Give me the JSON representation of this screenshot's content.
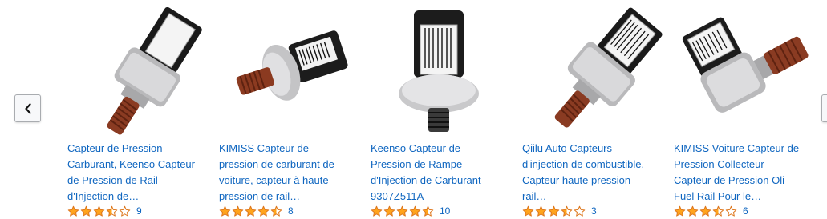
{
  "carousel": {
    "prev_icon": "chevron-left-icon",
    "products": [
      {
        "title": "Capteur de Pression Carburant, Keenso Capteur de Pression de Rail d'Injection de…",
        "rating": 3.5,
        "reviews": "9"
      },
      {
        "title": "KIMISS Capteur de pression de carburant de voiture, capteur à haute pression de rail…",
        "rating": 4.5,
        "reviews": "8"
      },
      {
        "title": "Keenso Capteur de Pression de Rampe d'Injection de Carburant 9307Z511A",
        "rating": 4.5,
        "reviews": "10"
      },
      {
        "title": "Qiilu Auto Capteurs d'injection de combustible, Capteur haute pression rail…",
        "rating": 3.5,
        "reviews": "3"
      },
      {
        "title": "KIMISS Voiture Capteur de Pression Collecteur Capteur de Pression Oli Fuel Rail Pour le…",
        "rating": 3.5,
        "reviews": "6"
      }
    ]
  },
  "colors": {
    "link": "#0f66c0",
    "star": "#ffa41c",
    "star_outline": "#de7921"
  }
}
